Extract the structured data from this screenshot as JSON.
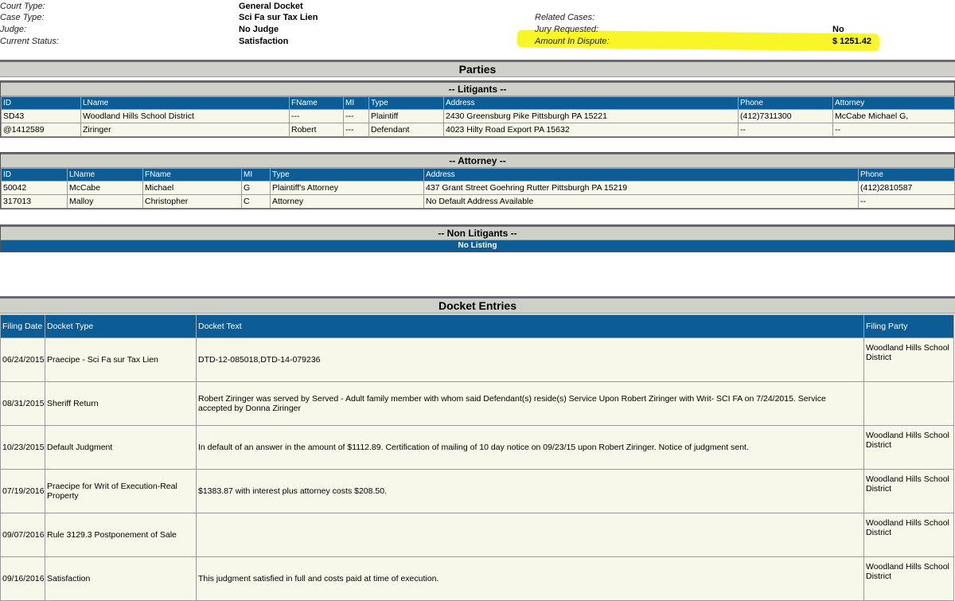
{
  "case_info": {
    "court_type_label": "Court Type:",
    "court_type_value": "General Docket",
    "case_type_label": "Case Type:",
    "case_type_value": "Sci Fa sur Tax Lien",
    "judge_label": "Judge:",
    "judge_value": "No Judge",
    "status_label": "Current Status:",
    "status_value": "Satisfaction",
    "related_label": "Related Cases:",
    "jury_label": "Jury Requested:",
    "jury_value": "No",
    "amount_label": "Amount In Dispute:",
    "amount_value": "$ 1251.42",
    "highlight_color": "#f7f500"
  },
  "parties": {
    "title": "Parties",
    "litigants": {
      "title": "-- Litigants --",
      "columns": [
        "ID",
        "LName",
        "FName",
        "MI",
        "Type",
        "Address",
        "Phone",
        "Attorney"
      ],
      "rows": [
        [
          "SD43",
          "Woodland Hills School District",
          "---",
          "---",
          "Plaintiff",
          "2430 Greensburg Pike Pittsburgh PA 15221",
          "(412)7311300",
          "McCabe Michael G,"
        ],
        [
          "@1412589",
          "Ziringer",
          "Robert",
          "---",
          "Defendant",
          "4023 Hilty Road Export PA 15632",
          "--",
          "--"
        ]
      ]
    },
    "attorney": {
      "title": "-- Attorney --",
      "columns": [
        "ID",
        "LName",
        "FName",
        "MI",
        "Type",
        "Address",
        "Phone"
      ],
      "rows": [
        [
          "50042",
          "McCabe",
          "Michael",
          "G",
          "Plaintiff's Attorney",
          "437 Grant Street Goehring Rutter Pittsburgh PA 15219",
          "(412)2810587"
        ],
        [
          "317013",
          "Malloy",
          "Christopher",
          "C",
          "Attorney",
          "No Default Address Available",
          "--"
        ]
      ]
    },
    "non_litigants": {
      "title": "-- Non Litigants --",
      "empty_text": "No Listing"
    }
  },
  "docket": {
    "title": "Docket Entries",
    "columns": [
      "Filing Date",
      "Docket Type",
      "Docket Text",
      "Filing Party"
    ],
    "rows": [
      [
        "06/24/2015",
        "Praecipe - Sci Fa sur Tax Lien",
        "DTD-12-085018,DTD-14-079236",
        "Woodland Hills School District"
      ],
      [
        "08/31/2015",
        "Sheriff Return",
        "Robert Ziringer was served by Served - Adult family member with whom said Defendant(s) reside(s) Service Upon Robert Ziringer with Writ- SCI FA on 7/24/2015. Service accepted by Donna Ziringer",
        ""
      ],
      [
        "10/23/2015",
        "Default Judgment",
        "In default of an answer in the amount of $1112.89. Certification of mailing of 10 day notice on 09/23/15 upon Robert Ziringer. Notice of judgment sent.",
        "Woodland Hills School District"
      ],
      [
        "07/19/2016",
        "Praecipe for Writ of Execution-Real Property",
        "$1383.87 with interest plus attorney costs $208.50.",
        "Woodland Hills School District"
      ],
      [
        "09/07/2016",
        "Rule 3129.3 Postponement of Sale",
        "",
        "Woodland Hills School District"
      ],
      [
        "09/16/2016",
        "Satisfaction",
        "This judgment satisfied in full and costs paid at time of execution.",
        "Woodland Hills School District"
      ]
    ]
  },
  "colors": {
    "header_blue": "#0c5d96",
    "section_gray": "#cfd0c8",
    "cell_bg": "#f7f7ea"
  }
}
